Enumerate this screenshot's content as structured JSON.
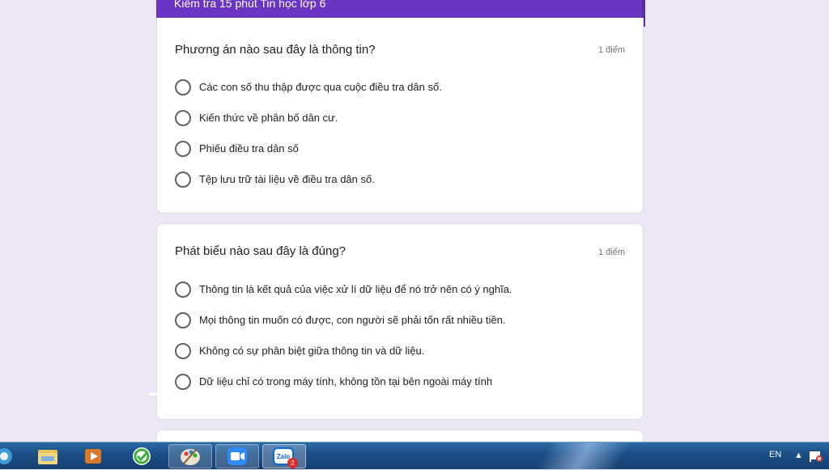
{
  "form": {
    "title": "Kiểm tra 15 phút Tin học lớp 6"
  },
  "questions": [
    {
      "title": "Phương án nào sau đây là thông tin?",
      "points": "1 điểm",
      "options": [
        "Các con số thu thập được qua cuộc điều tra dân số.",
        "Kiến thức về phân bố dân cư.",
        "Phiếu điều tra dân số",
        "Tệp lưu trữ tài liệu về điều tra dân số."
      ]
    },
    {
      "title": "Phát biểu nào sau đây là đúng?",
      "points": "1 điểm",
      "options": [
        "Thông tin là kết quả của việc xử lí dữ liệu để nó trở nên có ý nghĩa.",
        "Mọi thông tin muốn có được, con người sẽ phải tốn rất nhiều tiền.",
        "Không có sự phân biệt giữa thông tin và dữ liệu.",
        "Dữ liệu chỉ có trong máy tính, không tồn tại bên ngoài máy tính"
      ]
    }
  ],
  "taskbar": {
    "icons": [
      "ie-icon",
      "folder-icon",
      "media-player-icon",
      "green-app-icon",
      "paint-icon",
      "zoom-icon",
      "zalo-icon"
    ],
    "zalo_label": "Zalo",
    "zalo_badge": "2",
    "language": "EN"
  },
  "colors": {
    "accent": "#6a35c2",
    "background": "#ece6f6",
    "taskbar": "#1b4f86"
  }
}
